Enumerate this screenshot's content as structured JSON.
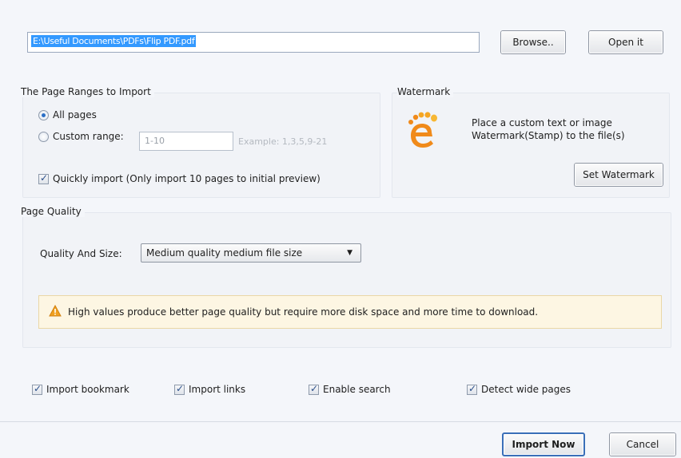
{
  "file": {
    "path_value": "E:\\Useful Documents\\PDFs\\Flip PDF.pdf",
    "browse_label": "Browse..",
    "open_label": "Open it"
  },
  "page_ranges": {
    "title": "The Page Ranges to Import",
    "all_pages_label": "All pages",
    "custom_range_label": "Custom range:",
    "custom_range_value": "1-10",
    "example_hint": "Example: 1,3,5,9-21",
    "quick_import_label": "Quickly import (Only import 10 pages to  initial  preview)",
    "selected": "all"
  },
  "watermark": {
    "title": "Watermark",
    "description_line1": "Place a custom text or image",
    "description_line2": "Watermark(Stamp) to the file(s)",
    "button_label": "Set Watermark"
  },
  "quality": {
    "title": "Page Quality",
    "label": "Quality And Size:",
    "selected": "Medium quality medium file size",
    "warning": "High values produce better page quality but require more disk space and more time to download."
  },
  "options": {
    "import_bookmark": "Import bookmark",
    "import_links": "Import links",
    "enable_search": "Enable search",
    "detect_wide_pages": "Detect wide pages"
  },
  "footer": {
    "import_label": "Import Now",
    "cancel_label": "Cancel"
  },
  "colors": {
    "selection": "#3399ff",
    "warning_bg": "#fdf6e3",
    "warning_icon": "#f0a020"
  },
  "icons": {
    "watermark": "footprint-e-icon",
    "warning": "warning-triangle-icon",
    "dropdown": "chevron-down-icon"
  }
}
